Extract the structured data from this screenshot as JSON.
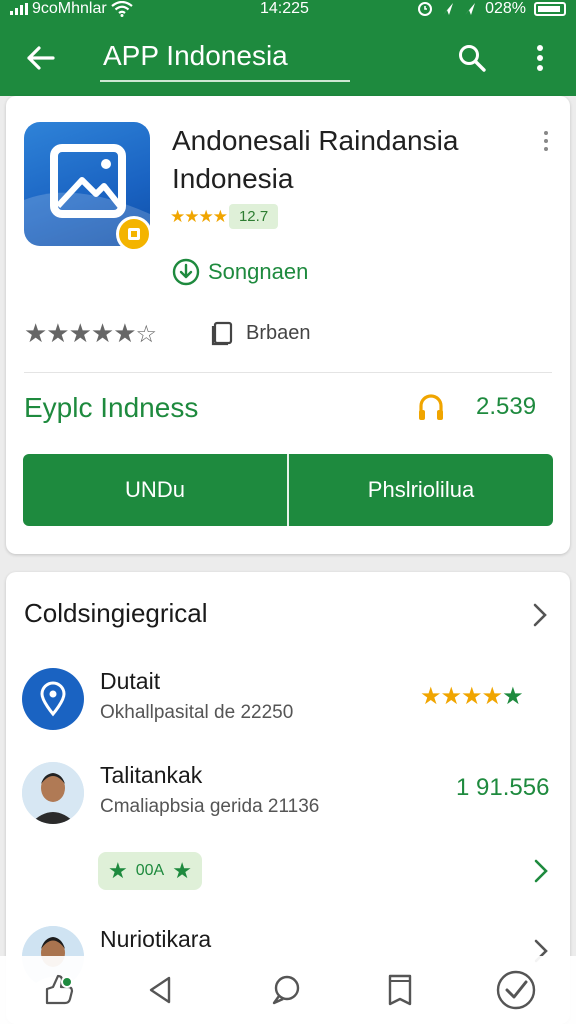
{
  "status_bar": {
    "carrier": "9coMhnlar",
    "time": "14:225",
    "battery_text": "028%"
  },
  "app_bar": {
    "title": "APP Indonesia",
    "icons": [
      "back-arrow-icon",
      "search-icon",
      "more-vert-icon"
    ]
  },
  "app_card": {
    "name_line1": "Andonesali Raindansia",
    "name_line2": "Indonesia",
    "rating_stars": "★★★★",
    "rating_value": "12.7",
    "download_status": "Songnaen",
    "bookmark_label": "Brbaen",
    "developer": "Eyplc Indness",
    "count": "2.539",
    "buttons": {
      "primary": "UNDu",
      "secondary": "Phslriolilua"
    }
  },
  "section": {
    "title": "Coldsingiegrical",
    "items": [
      {
        "name": "Dutait",
        "subtitle": "Okhallpasital de 22250",
        "rating_stars": 5
      },
      {
        "name": "Talitankak",
        "subtitle": "Cmaliapbsia gerida 21136",
        "count": "1 91.556",
        "tag": "00A"
      },
      {
        "name": "Nuriotikara"
      }
    ]
  },
  "bottom_nav": [
    "thumbs-up-icon",
    "back-triangle-icon",
    "chat-bubble-icon",
    "book-icon",
    "verified-check-icon"
  ],
  "colors": {
    "primary": "#1e8a3e",
    "star": "#f0a500",
    "app_icon_blue": "#1a63c2"
  }
}
